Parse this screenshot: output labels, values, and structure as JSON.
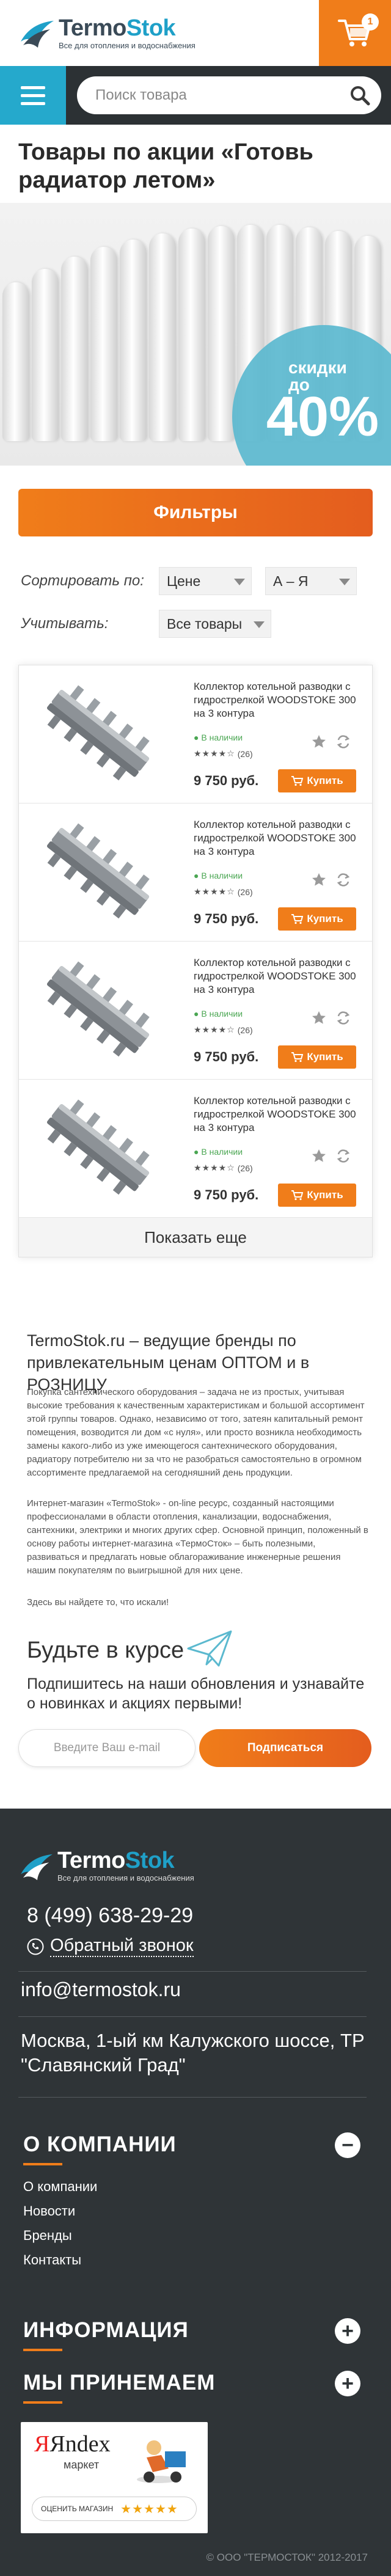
{
  "header": {
    "logo_name_1": "Termo",
    "logo_name_2": "Stok",
    "logo_sub": "Все для отопления и водоснабжения",
    "cart_count": "1"
  },
  "search": {
    "placeholder": "Поиск товара"
  },
  "page": {
    "title": "Товары по акции «Готовь радиатор летом»"
  },
  "banner": {
    "discount_label": "скидки до",
    "discount_value": "40%"
  },
  "filters": {
    "button_label": "Фильтры",
    "sort_label": "Сортировать по:",
    "sort_value": "Цене",
    "sort_order": "А – Я",
    "consider_label": "Учитывать:",
    "consider_value": "Все товары"
  },
  "products": [
    {
      "title": "Коллектор котельной разводки с гидрострелкой WOODSTOKE 300 на 3 контура",
      "stock": "В наличии",
      "stars": "★★★★☆",
      "reviews": "(26)",
      "price": "9 750 руб.",
      "buy": "Купить"
    },
    {
      "title": "Коллектор котельной разводки с гидрострелкой WOODSTOKE 300 на 3 контура",
      "stock": "В наличии",
      "stars": "★★★★☆",
      "reviews": "(26)",
      "price": "9 750 руб.",
      "buy": "Купить"
    },
    {
      "title": "Коллектор котельной разводки с гидрострелкой WOODSTOKE 300 на 3 контура",
      "stock": "В наличии",
      "stars": "★★★★☆",
      "reviews": "(26)",
      "price": "9 750 руб.",
      "buy": "Купить"
    },
    {
      "title": "Коллектор котельной разводки с гидрострелкой WOODSTOKE 300 на 3 контура",
      "stock": "В наличии",
      "stars": "★★★★☆",
      "reviews": "(26)",
      "price": "9 750 руб.",
      "buy": "Купить"
    }
  ],
  "show_more": "Показать еще",
  "seo": {
    "title": "TermoStok.ru – ведущие бренды по привлекательным ценам ОПТОМ и в РОЗНИЦУ",
    "p1": "Покупка сантехнического оборудования – задача не из простых, учитывая высокие требования к качественным характеристикам и большой ассортимент этой группы товаров. Однако, независимо от того, затеян капитальный ремонт помещения, возводится ли дом «с нуля», или просто возникла необходимость замены какого-либо из уже имеющегося сантехнического оборудования, радиатору потребителю ни за что не разобраться самостоятельно в огромном ассортименте предлагаемой на сегодняшний день продукции.",
    "p2": "Интернет-магазин «TermoStok» - on-line ресурс, созданный настоящими профессионалами в области отопления, канализации, водоснабжения, сантехники, электрики и многих других сфер. Основной принцип, положенный в основу работы интернет-магазина «ТермоСток» – быть полезными, развиваться и предлагать новые облагораживание инженерные решения нашим покупателям по выигрышной для них цене.",
    "p3": "Здесь вы найдете то, что искали!"
  },
  "subscribe": {
    "title": "Будьте в курсе",
    "desc": "Подпишитесь на наши обновления и узнавайте о новинках и акциях первыми!",
    "email_placeholder": "Введите Ваш e-mail",
    "button": "Подписаться"
  },
  "footer": {
    "phone": "8 (499) 638-29-29",
    "callback": "Обратный звонок",
    "email": "info@termostok.ru",
    "address": "Москва, 1-ый км Калужского шоссе, ТР \"Славянский Град\"",
    "about_title": "О КОМПАНИИ",
    "about_links": [
      "О компании",
      "Новости",
      "Бренды",
      "Контакты"
    ],
    "info_title": "ИНФОРМАЦИЯ",
    "accept_title": "МЫ ПРИНЕМАЕМ",
    "market_brand": "Яndex",
    "market_sub": "маркет",
    "market_rate": "ОЦЕНИТЬ МАГАЗИН",
    "copyright": "© ООО \"ТЕРМОСТОК\" 2012-2017"
  },
  "colors": {
    "accent": "#f07d1a",
    "brand_blue": "#25a9cc",
    "footer_bg": "#2f3437"
  }
}
